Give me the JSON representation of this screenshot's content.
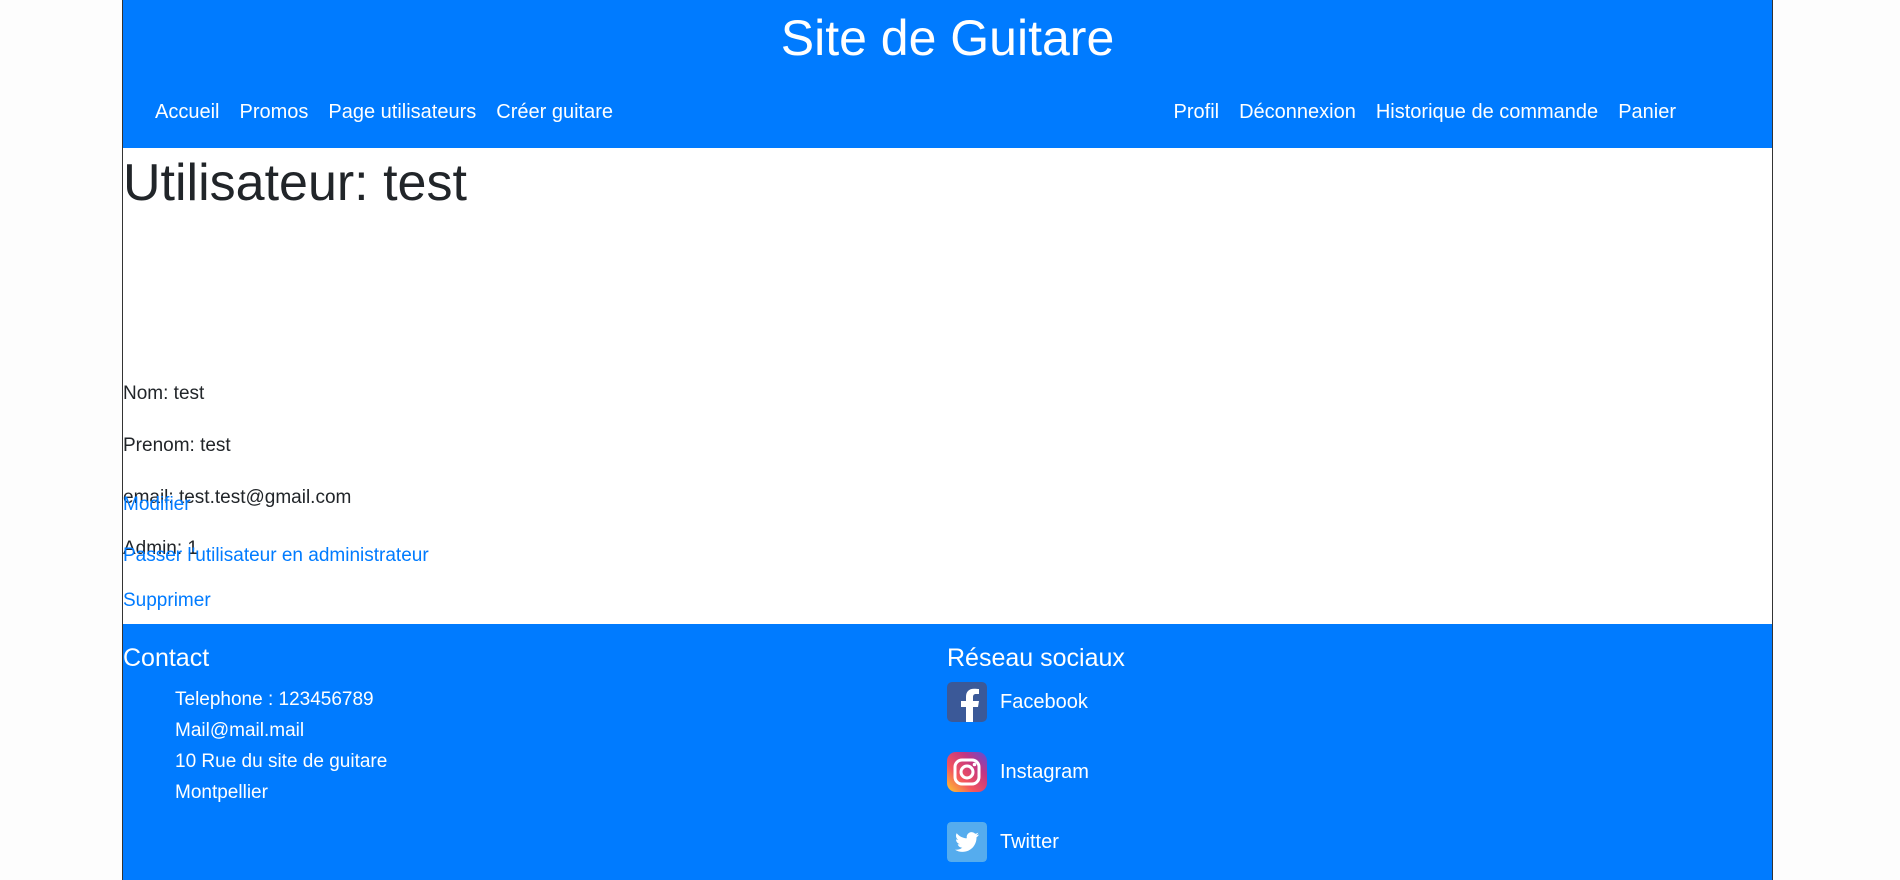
{
  "header": {
    "site_title": "Site de Guitare",
    "nav_left": [
      "Accueil",
      "Promos",
      "Page utilisateurs",
      "Créer guitare"
    ],
    "nav_right": [
      "Profil",
      "Déconnexion",
      "Historique de commande",
      "Panier"
    ]
  },
  "main": {
    "title": "Utilisateur: test",
    "fields": [
      "Nom: test",
      "Prenom: test",
      "email: test.test@gmail.com",
      "Admin: 1"
    ],
    "actions": [
      "Supprimer",
      "Modifier",
      "Passer l'utilisateur en administrateur"
    ]
  },
  "footer": {
    "contact": {
      "title": "Contact",
      "lines": [
        "Telephone : 123456789",
        "Mail@mail.mail",
        "10 Rue du site de guitare",
        "Montpellier"
      ]
    },
    "social": {
      "title": "Réseau sociaux",
      "items": [
        {
          "label": "Facebook",
          "icon": "facebook-icon"
        },
        {
          "label": "Instagram",
          "icon": "instagram-icon"
        },
        {
          "label": "Twitter",
          "icon": "twitter-icon"
        }
      ]
    }
  },
  "colors": {
    "primary": "#007bff",
    "link": "#007bff",
    "text": "#212529"
  }
}
